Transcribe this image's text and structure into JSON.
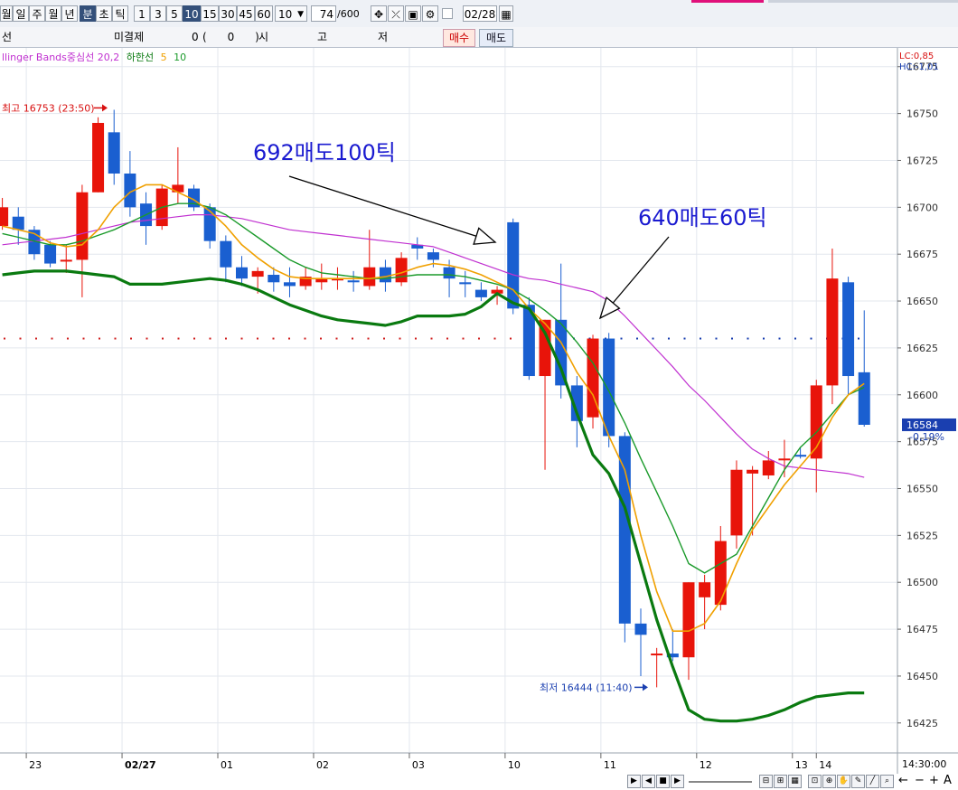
{
  "toolbar": {
    "period_buttons": [
      "월",
      "일",
      "주",
      "월",
      "년"
    ],
    "unit_buttons": [
      "분",
      "초",
      "틱"
    ],
    "interval_buttons": [
      "1",
      "3",
      "5",
      "10",
      "15",
      "30",
      "45",
      "60"
    ],
    "interval_value": "10",
    "count_value": "74",
    "count_max": "/600",
    "date_value": "02/28"
  },
  "infobar": {
    "left_label": "선",
    "unsettled_label": "미결제",
    "unsettled_value": "0",
    "unsettled_paren": "(      0      )",
    "open_label": "시",
    "high_label": "고",
    "low_label": "저",
    "buy_label": "매수",
    "sell_label": "매도"
  },
  "chart_data": {
    "type": "candlestick",
    "legend": {
      "bb_text": "llinger Bands중심선 20,2",
      "lower_text": "하한선",
      "ma5": "5",
      "ma10": "10"
    },
    "colors": {
      "up": "#e8140a",
      "down": "#1a5fd0",
      "bb_mid": "#c030d0",
      "bb_lower": "#0a7a10",
      "ma5": "#f0a000",
      "ma10": "#1a9a2a",
      "dots": "#d02020",
      "dots_right": "#1a3fb0"
    },
    "corner": {
      "lc": "LC:0,85",
      "hc": "HC:-1,01"
    },
    "y_ticks": [
      16775,
      16750,
      16725,
      16700,
      16675,
      16650,
      16625,
      16600,
      16575,
      16550,
      16525,
      16500,
      16475,
      16450,
      16425
    ],
    "y_tick_labels": [
      "16775",
      "16750",
      "16725",
      "16700",
      "16675",
      "16650",
      "16625",
      "16600",
      "16575",
      "16550",
      "16525",
      "16500",
      "16475",
      "16450",
      "16425"
    ],
    "ylim": [
      16409,
      16785
    ],
    "x_labels": [
      {
        "i": 1.5,
        "label": "23"
      },
      {
        "i": 7.5,
        "label": "02/27"
      },
      {
        "i": 13.5,
        "label": "01"
      },
      {
        "i": 19.5,
        "label": "02"
      },
      {
        "i": 25.5,
        "label": "03"
      },
      {
        "i": 31.5,
        "label": "10"
      },
      {
        "i": 37.5,
        "label": "11"
      },
      {
        "i": 43.5,
        "label": "12"
      },
      {
        "i": 49.5,
        "label": "13"
      },
      {
        "i": 51.0,
        "label": "14"
      }
    ],
    "x_right_label": "14:30:00",
    "current_price": "16584",
    "current_change": "-0,19%",
    "candles": [
      {
        "o": 16690,
        "h": 16705,
        "l": 16688,
        "c": 16700
      },
      {
        "o": 16695,
        "h": 16700,
        "l": 16680,
        "c": 16688
      },
      {
        "o": 16688,
        "h": 16690,
        "l": 16672,
        "c": 16675
      },
      {
        "o": 16680,
        "h": 16682,
        "l": 16668,
        "c": 16670
      },
      {
        "o": 16672,
        "h": 16680,
        "l": 16665,
        "c": 16672
      },
      {
        "o": 16672,
        "h": 16712,
        "l": 16652,
        "c": 16708
      },
      {
        "o": 16708,
        "h": 16748,
        "l": 16708,
        "c": 16745
      },
      {
        "o": 16740,
        "h": 16752,
        "l": 16712,
        "c": 16718
      },
      {
        "o": 16718,
        "h": 16730,
        "l": 16695,
        "c": 16700
      },
      {
        "o": 16702,
        "h": 16708,
        "l": 16680,
        "c": 16690
      },
      {
        "o": 16690,
        "h": 16712,
        "l": 16688,
        "c": 16710
      },
      {
        "o": 16708,
        "h": 16732,
        "l": 16702,
        "c": 16712
      },
      {
        "o": 16710,
        "h": 16712,
        "l": 16698,
        "c": 16700
      },
      {
        "o": 16700,
        "h": 16702,
        "l": 16678,
        "c": 16682
      },
      {
        "o": 16682,
        "h": 16685,
        "l": 16660,
        "c": 16668
      },
      {
        "o": 16668,
        "h": 16674,
        "l": 16658,
        "c": 16662
      },
      {
        "o": 16663,
        "h": 16668,
        "l": 16654,
        "c": 16666
      },
      {
        "o": 16664,
        "h": 16668,
        "l": 16655,
        "c": 16660
      },
      {
        "o": 16660,
        "h": 16668,
        "l": 16652,
        "c": 16658
      },
      {
        "o": 16658,
        "h": 16668,
        "l": 16656,
        "c": 16663
      },
      {
        "o": 16660,
        "h": 16670,
        "l": 16656,
        "c": 16662
      },
      {
        "o": 16661,
        "h": 16668,
        "l": 16656,
        "c": 16662
      },
      {
        "o": 16661,
        "h": 16666,
        "l": 16655,
        "c": 16660
      },
      {
        "o": 16658,
        "h": 16688,
        "l": 16656,
        "c": 16668
      },
      {
        "o": 16668,
        "h": 16672,
        "l": 16655,
        "c": 16660
      },
      {
        "o": 16660,
        "h": 16676,
        "l": 16658,
        "c": 16673
      },
      {
        "o": 16680,
        "h": 16684,
        "l": 16672,
        "c": 16678
      },
      {
        "o": 16676,
        "h": 16678,
        "l": 16668,
        "c": 16672
      },
      {
        "o": 16668,
        "h": 16672,
        "l": 16652,
        "c": 16662
      },
      {
        "o": 16660,
        "h": 16666,
        "l": 16652,
        "c": 16659
      },
      {
        "o": 16656,
        "h": 16660,
        "l": 16650,
        "c": 16652
      },
      {
        "o": 16654,
        "h": 16658,
        "l": 16648,
        "c": 16656
      },
      {
        "o": 16692,
        "h": 16694,
        "l": 16643,
        "c": 16646
      },
      {
        "o": 16648,
        "h": 16652,
        "l": 16608,
        "c": 16610
      },
      {
        "o": 16610,
        "h": 16640,
        "l": 16560,
        "c": 16640
      },
      {
        "o": 16640,
        "h": 16670,
        "l": 16598,
        "c": 16605
      },
      {
        "o": 16605,
        "h": 16610,
        "l": 16572,
        "c": 16586
      },
      {
        "o": 16588,
        "h": 16632,
        "l": 16582,
        "c": 16630
      },
      {
        "o": 16630,
        "h": 16633,
        "l": 16572,
        "c": 16578
      },
      {
        "o": 16578,
        "h": 16580,
        "l": 16468,
        "c": 16478
      },
      {
        "o": 16478,
        "h": 16486,
        "l": 16450,
        "c": 16472
      },
      {
        "o": 16462,
        "h": 16465,
        "l": 16444,
        "c": 16462
      },
      {
        "o": 16462,
        "h": 16475,
        "l": 16458,
        "c": 16460
      },
      {
        "o": 16460,
        "h": 16500,
        "l": 16448,
        "c": 16500
      },
      {
        "o": 16492,
        "h": 16504,
        "l": 16475,
        "c": 16500
      },
      {
        "o": 16488,
        "h": 16530,
        "l": 16485,
        "c": 16522
      },
      {
        "o": 16525,
        "h": 16565,
        "l": 16518,
        "c": 16560
      },
      {
        "o": 16558,
        "h": 16562,
        "l": 16525,
        "c": 16560
      },
      {
        "o": 16557,
        "h": 16570,
        "l": 16555,
        "c": 16565
      },
      {
        "o": 16566,
        "h": 16576,
        "l": 16556,
        "c": 16566
      },
      {
        "o": 16568,
        "h": 16572,
        "l": 16566,
        "c": 16567
      },
      {
        "o": 16566,
        "h": 16608,
        "l": 16548,
        "c": 16605
      },
      {
        "o": 16605,
        "h": 16678,
        "l": 16595,
        "c": 16662
      },
      {
        "o": 16660,
        "h": 16663,
        "l": 16600,
        "c": 16610
      },
      {
        "o": 16612,
        "h": 16645,
        "l": 16583,
        "c": 16584
      }
    ],
    "bb_mid": [
      16680,
      16681,
      16682,
      16683,
      16684,
      16686,
      16688,
      16690,
      16692,
      16693,
      16694,
      16695,
      16696,
      16696,
      16695,
      16694,
      16692,
      16690,
      16688,
      16687,
      16686,
      16685,
      16684,
      16683,
      16682,
      16681,
      16680,
      16679,
      16676,
      16673,
      16670,
      16667,
      16664,
      16662,
      16661,
      16659,
      16657,
      16655,
      16650,
      16642,
      16633,
      16624,
      16615,
      16605,
      16597,
      16588,
      16579,
      16571,
      16566,
      16562,
      16561,
      16560,
      16559,
      16558,
      16556
    ],
    "bb_lower": [
      16664,
      16665,
      16666,
      16666,
      16666,
      16665,
      16664,
      16663,
      16659,
      16659,
      16659,
      16660,
      16661,
      16662,
      16661,
      16659,
      16656,
      16652,
      16648,
      16645,
      16642,
      16640,
      16639,
      16638,
      16637,
      16639,
      16642,
      16642,
      16642,
      16643,
      16647,
      16654,
      16649,
      16646,
      16633,
      16614,
      16590,
      16568,
      16558,
      16540,
      16510,
      16480,
      16455,
      16432,
      16427,
      16426,
      16426,
      16427,
      16429,
      16432,
      16436,
      16439,
      16440,
      16441,
      16441
    ],
    "ma5": [
      16690,
      16688,
      16686,
      16681,
      16679,
      16680,
      16688,
      16700,
      16708,
      16712,
      16712,
      16708,
      16704,
      16698,
      16690,
      16680,
      16673,
      16667,
      16663,
      16662,
      16662,
      16662,
      16662,
      16662,
      16663,
      16665,
      16668,
      16670,
      16669,
      16667,
      16664,
      16660,
      16656,
      16646,
      16638,
      16628,
      16612,
      16600,
      16578,
      16560,
      16525,
      16495,
      16474,
      16474,
      16478,
      16490,
      16510,
      16528,
      16540,
      16552,
      16562,
      16572,
      16588,
      16600,
      16606
    ],
    "ma10": [
      16686,
      16684,
      16682,
      16680,
      16680,
      16682,
      16685,
      16688,
      16692,
      16696,
      16700,
      16702,
      16702,
      16700,
      16696,
      16690,
      16684,
      16678,
      16672,
      16668,
      16665,
      16664,
      16663,
      16662,
      16662,
      16663,
      16664,
      16664,
      16664,
      16663,
      16661,
      16659,
      16656,
      16651,
      16645,
      16638,
      16628,
      16617,
      16602,
      16585,
      16566,
      16548,
      16530,
      16510,
      16505,
      16510,
      16515,
      16530,
      16545,
      16560,
      16572,
      16580,
      16590,
      16600,
      16604
    ],
    "dots_price": 16630,
    "annotations": [
      {
        "text": "692매도100틱",
        "x1": 320,
        "y1": 195,
        "x2": 548,
        "y2": 268
      },
      {
        "text": "640매도60틱",
        "x1": 740,
        "y1": 262,
        "x2": 664,
        "y2": 352
      }
    ],
    "markers": [
      {
        "text": "최고 16753 (23:50)",
        "price": 16753,
        "color": "#d81010"
      },
      {
        "text": "최저 16444 (11:40)",
        "price": 16444,
        "color": "#1a3fb0"
      }
    ]
  }
}
